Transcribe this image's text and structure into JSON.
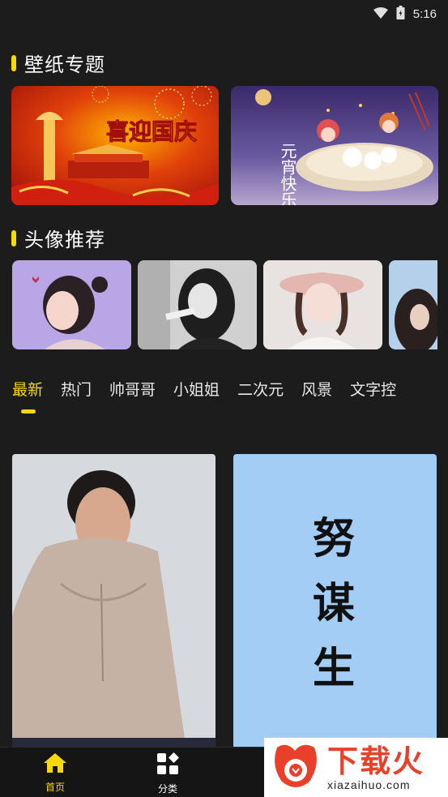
{
  "status_bar": {
    "time": "5:16"
  },
  "sections": {
    "wallpaper_topics": {
      "title": "壁纸专题"
    },
    "avatar_recommend": {
      "title": "头像推荐"
    }
  },
  "topic_cards": [
    {
      "text": "喜迎国庆"
    },
    {
      "text": "元宵快乐"
    }
  ],
  "category_tabs": [
    "最新",
    "热门",
    "帅哥哥",
    "小姐姐",
    "二次元",
    "风景",
    "文字控"
  ],
  "active_tab": "最新",
  "feed_card_2": {
    "lines": [
      "努",
      "谋",
      "生"
    ]
  },
  "bottom_nav": {
    "home_label": "首页",
    "category_label": "分类"
  },
  "watermark": {
    "brand": "下载火",
    "domain": "xiazaihuo.com"
  },
  "colors": {
    "accent": "#f5d90a",
    "background": "#1c1c1c",
    "watermark_red": "#e8402a"
  }
}
